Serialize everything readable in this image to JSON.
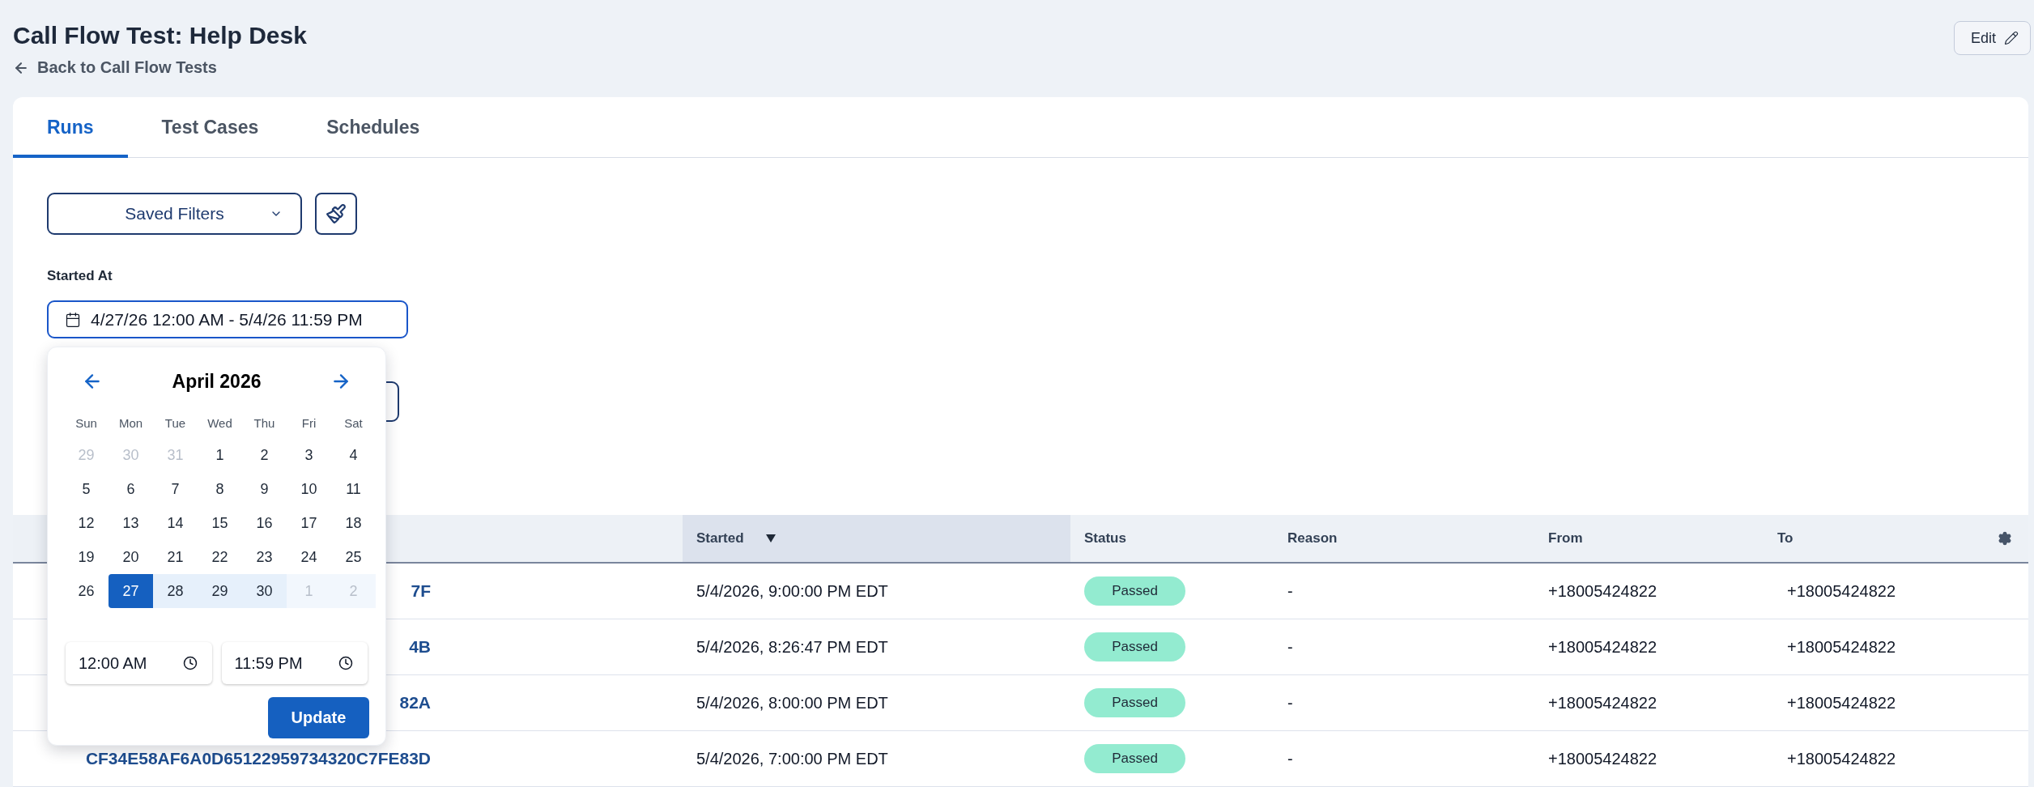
{
  "page": {
    "title": "Call Flow Test: Help Desk",
    "back_link": "Back to Call Flow Tests",
    "edit_button": "Edit"
  },
  "tabs": [
    {
      "label": "Runs",
      "selected": true
    },
    {
      "label": "Test Cases",
      "selected": false
    },
    {
      "label": "Schedules",
      "selected": false
    }
  ],
  "filters": {
    "saved_filters": "Saved Filters",
    "started_at_label": "Started At",
    "date_range": "4/27/26 12:00 AM - 5/4/26 11:59 PM"
  },
  "date_picker": {
    "month": "April 2026",
    "weekdays": [
      "Sun",
      "Mon",
      "Tue",
      "Wed",
      "Thu",
      "Fri",
      "Sat"
    ],
    "weeks": [
      [
        {
          "label": "29",
          "outside_month": true,
          "selected": false,
          "in_range": false
        },
        {
          "label": "30",
          "outside_month": true,
          "selected": false,
          "in_range": false
        },
        {
          "label": "31",
          "outside_month": true,
          "selected": false,
          "in_range": false
        },
        {
          "label": "1",
          "outside_month": false,
          "selected": false,
          "in_range": false
        },
        {
          "label": "2",
          "outside_month": false,
          "selected": false,
          "in_range": false
        },
        {
          "label": "3",
          "outside_month": false,
          "selected": false,
          "in_range": false
        },
        {
          "label": "4",
          "outside_month": false,
          "selected": false,
          "in_range": false
        }
      ],
      [
        {
          "label": "5",
          "outside_month": false,
          "selected": false,
          "in_range": false
        },
        {
          "label": "6",
          "outside_month": false,
          "selected": false,
          "in_range": false
        },
        {
          "label": "7",
          "outside_month": false,
          "selected": false,
          "in_range": false
        },
        {
          "label": "8",
          "outside_month": false,
          "selected": false,
          "in_range": false
        },
        {
          "label": "9",
          "outside_month": false,
          "selected": false,
          "in_range": false
        },
        {
          "label": "10",
          "outside_month": false,
          "selected": false,
          "in_range": false
        },
        {
          "label": "11",
          "outside_month": false,
          "selected": false,
          "in_range": false
        }
      ],
      [
        {
          "label": "12",
          "outside_month": false,
          "selected": false,
          "in_range": false
        },
        {
          "label": "13",
          "outside_month": false,
          "selected": false,
          "in_range": false
        },
        {
          "label": "14",
          "outside_month": false,
          "selected": false,
          "in_range": false
        },
        {
          "label": "15",
          "outside_month": false,
          "selected": false,
          "in_range": false
        },
        {
          "label": "16",
          "outside_month": false,
          "selected": false,
          "in_range": false
        },
        {
          "label": "17",
          "outside_month": false,
          "selected": false,
          "in_range": false
        },
        {
          "label": "18",
          "outside_month": false,
          "selected": false,
          "in_range": false
        }
      ],
      [
        {
          "label": "19",
          "outside_month": false,
          "selected": false,
          "in_range": false
        },
        {
          "label": "20",
          "outside_month": false,
          "selected": false,
          "in_range": false
        },
        {
          "label": "21",
          "outside_month": false,
          "selected": false,
          "in_range": false
        },
        {
          "label": "22",
          "outside_month": false,
          "selected": false,
          "in_range": false
        },
        {
          "label": "23",
          "outside_month": false,
          "selected": false,
          "in_range": false
        },
        {
          "label": "24",
          "outside_month": false,
          "selected": false,
          "in_range": false
        },
        {
          "label": "25",
          "outside_month": false,
          "selected": false,
          "in_range": false
        }
      ],
      [
        {
          "label": "26",
          "outside_month": false,
          "selected": false,
          "in_range": false
        },
        {
          "label": "27",
          "outside_month": false,
          "selected": true,
          "in_range": true
        },
        {
          "label": "28",
          "outside_month": false,
          "selected": false,
          "in_range": true
        },
        {
          "label": "29",
          "outside_month": false,
          "selected": false,
          "in_range": true
        },
        {
          "label": "30",
          "outside_month": false,
          "selected": false,
          "in_range": true
        },
        {
          "label": "1",
          "outside_month": true,
          "selected": false,
          "in_range": true
        },
        {
          "label": "2",
          "outside_month": true,
          "selected": false,
          "in_range": true
        }
      ]
    ],
    "start_time": "12:00 AM",
    "end_time": "11:59 PM",
    "update_button": "Update"
  },
  "table": {
    "columns": [
      {
        "label": "Started",
        "sorted": true
      },
      {
        "label": "Status",
        "sorted": false
      },
      {
        "label": "Reason",
        "sorted": false
      },
      {
        "label": "From",
        "sorted": false
      },
      {
        "label": "To",
        "sorted": false
      }
    ],
    "rows": [
      {
        "id": "7F",
        "started": "5/4/2026, 9:00:00 PM EDT",
        "status": {
          "label": "Passed",
          "kind": "passed"
        },
        "reason": "-",
        "from": "+18005424822",
        "to": "+18005424822"
      },
      {
        "id": "4B",
        "started": "5/4/2026, 8:26:47 PM EDT",
        "status": {
          "label": "Passed",
          "kind": "passed"
        },
        "reason": "-",
        "from": "+18005424822",
        "to": "+18005424822"
      },
      {
        "id": "82A",
        "started": "5/4/2026, 8:00:00 PM EDT",
        "status": {
          "label": "Passed",
          "kind": "passed"
        },
        "reason": "-",
        "from": "+18005424822",
        "to": "+18005424822"
      },
      {
        "id": "CF34E58AF6A0D65122959734320C7FE83D",
        "started": "5/4/2026, 7:00:00 PM EDT",
        "status": {
          "label": "Passed",
          "kind": "passed"
        },
        "reason": "-",
        "from": "+18005424822",
        "to": "+18005424822"
      }
    ]
  }
}
